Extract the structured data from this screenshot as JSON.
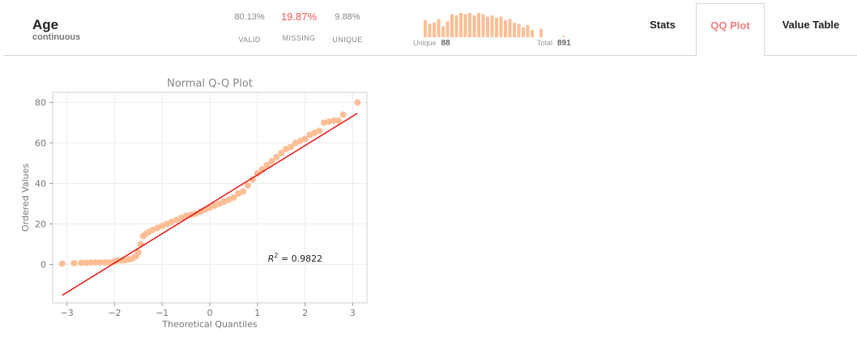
{
  "column": {
    "name": "Age",
    "type": "continuous"
  },
  "stats": [
    {
      "value": "80.13%",
      "label": "VALID",
      "missing": false
    },
    {
      "value": "19.87%",
      "label": "MISSING",
      "missing": true
    },
    {
      "value": "9.88%",
      "label": "UNIQUE",
      "missing": false
    }
  ],
  "minihist": {
    "color": "#ffbe95",
    "bars": [
      0.7,
      0.55,
      0.6,
      0.75,
      0.45,
      0.65,
      0.95,
      0.9,
      1.0,
      0.95,
      1.0,
      0.9,
      1.0,
      0.95,
      0.85,
      0.9,
      0.8,
      0.85,
      0.7,
      0.75,
      0.6,
      0.55,
      0.4,
      0.5,
      0.3,
      0,
      0.35,
      0,
      0,
      0,
      0,
      0.05
    ],
    "unique_label": "Unique",
    "unique_value": "88",
    "total_label": "Total",
    "total_value": "891"
  },
  "tabs": [
    {
      "label": "Stats",
      "active": false
    },
    {
      "label": "QQ Plot",
      "active": true
    },
    {
      "label": "Value Table",
      "active": false
    }
  ],
  "chart_data": {
    "type": "scatter",
    "title": "Normal Q-Q Plot",
    "xlabel": "Theoretical Quantiles",
    "ylabel": "Ordered Values",
    "xlim": [
      -3.3,
      3.3
    ],
    "ylim": [
      -19,
      85
    ],
    "xticks": [
      -3,
      -2,
      -1,
      0,
      1,
      2,
      3
    ],
    "xtick_labels": [
      "−3",
      "−2",
      "−1",
      "0",
      "1",
      "2",
      "3"
    ],
    "yticks": [
      0,
      20,
      40,
      60,
      80
    ],
    "yticks_labels": [
      "0",
      "20",
      "40",
      "60",
      "80"
    ],
    "grid": true,
    "point_color": "#ffbe95",
    "line_color": "#ee1111",
    "fit_line": {
      "slope": 14.5,
      "intercept": 29.7
    },
    "r2_label": "= 0.9822",
    "quantile_points": [
      [
        -3.1,
        0.42
      ],
      [
        -2.85,
        0.67
      ],
      [
        -2.7,
        0.75
      ],
      [
        -2.6,
        0.83
      ],
      [
        -2.5,
        0.92
      ],
      [
        -2.4,
        1.0
      ],
      [
        -2.3,
        1.0
      ],
      [
        -2.2,
        1.0
      ],
      [
        -2.1,
        1.0
      ],
      [
        -2.0,
        1.5
      ],
      [
        -1.92,
        2.0
      ],
      [
        -1.85,
        2.0
      ],
      [
        -1.78,
        2.0
      ],
      [
        -1.7,
        2.5
      ],
      [
        -1.62,
        3.0
      ],
      [
        -1.55,
        4.0
      ],
      [
        -1.5,
        6.0
      ],
      [
        -1.45,
        10.0
      ],
      [
        -1.4,
        14.0
      ],
      [
        -1.35,
        15.0
      ],
      [
        -1.28,
        16.0
      ],
      [
        -1.2,
        17.0
      ],
      [
        -1.1,
        18.0
      ],
      [
        -1.0,
        19.0
      ],
      [
        -0.9,
        20.0
      ],
      [
        -0.8,
        21.0
      ],
      [
        -0.7,
        22.0
      ],
      [
        -0.6,
        23.0
      ],
      [
        -0.5,
        24.0
      ],
      [
        -0.4,
        24.5
      ],
      [
        -0.3,
        25.0
      ],
      [
        -0.2,
        26.0
      ],
      [
        -0.1,
        27.0
      ],
      [
        0.0,
        28.0
      ],
      [
        0.1,
        29.0
      ],
      [
        0.2,
        30.0
      ],
      [
        0.3,
        31.0
      ],
      [
        0.4,
        32.0
      ],
      [
        0.5,
        33.0
      ],
      [
        0.6,
        35.0
      ],
      [
        0.7,
        36.0
      ],
      [
        0.8,
        39.0
      ],
      [
        0.9,
        42.0
      ],
      [
        1.0,
        45.0
      ],
      [
        1.1,
        47.0
      ],
      [
        1.2,
        49.0
      ],
      [
        1.3,
        51.0
      ],
      [
        1.4,
        53.0
      ],
      [
        1.5,
        55.0
      ],
      [
        1.6,
        57.0
      ],
      [
        1.7,
        58.0
      ],
      [
        1.8,
        60.0
      ],
      [
        1.9,
        61.0
      ],
      [
        2.0,
        62.0
      ],
      [
        2.1,
        64.0
      ],
      [
        2.2,
        65.0
      ],
      [
        2.3,
        66.0
      ],
      [
        2.4,
        70.0
      ],
      [
        2.5,
        70.5
      ],
      [
        2.6,
        71.0
      ],
      [
        2.7,
        71.0
      ],
      [
        2.8,
        74.0
      ],
      [
        3.1,
        80.0
      ]
    ]
  }
}
